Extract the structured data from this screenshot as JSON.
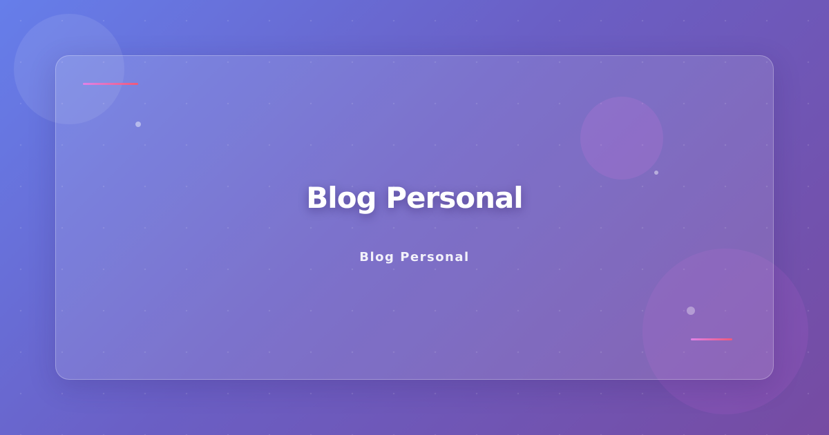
{
  "header": {
    "title": "Blog Personal",
    "subtitle": "Blog Personal"
  },
  "colors": {
    "background_start": "#667eea",
    "background_end": "#764ba2",
    "accent_start": "#e082e8",
    "accent_end": "#f0587a",
    "text": "#ffffff"
  }
}
